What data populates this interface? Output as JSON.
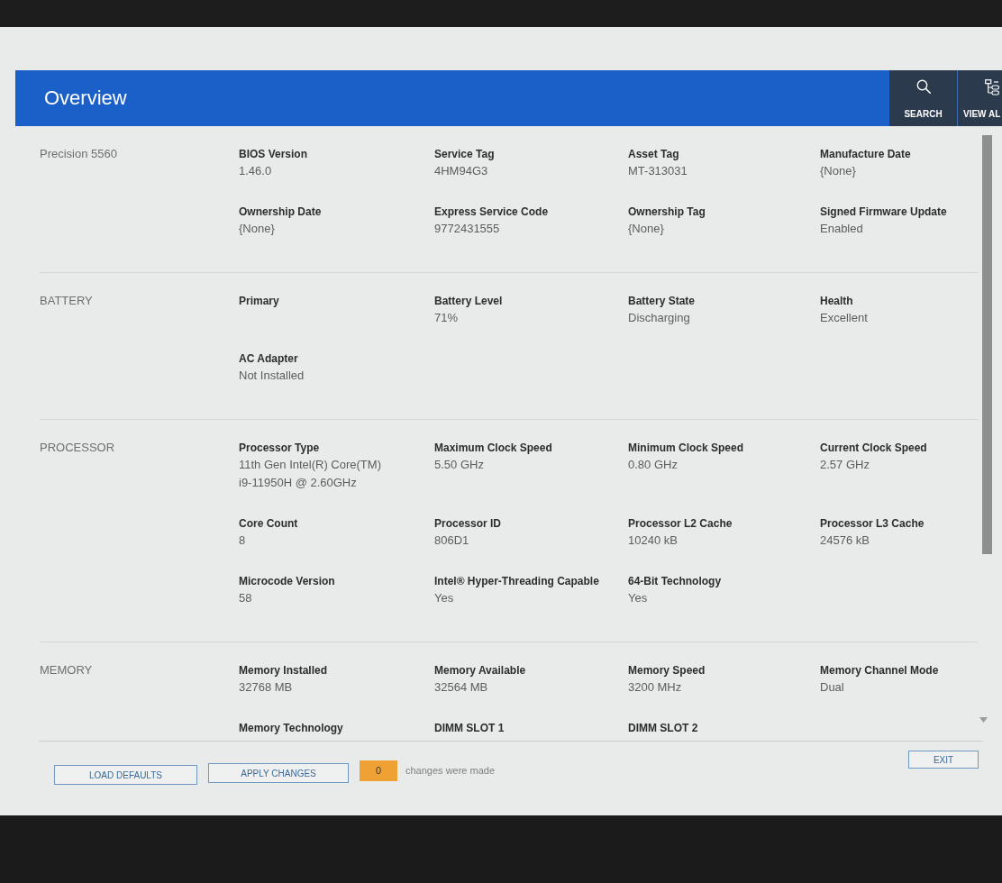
{
  "header": {
    "title": "Overview",
    "actions": [
      {
        "kind": "search",
        "label": "SEARCH"
      },
      {
        "kind": "hierarchy",
        "label": "VIEW AL"
      }
    ]
  },
  "sections": [
    {
      "title": "Precision 5560",
      "fields": [
        {
          "label": "BIOS Version",
          "value": "1.46.0"
        },
        {
          "label": "Service Tag",
          "value": "4HM94G3"
        },
        {
          "label": "Asset Tag",
          "value": "MT-313031"
        },
        {
          "label": "Manufacture Date",
          "value": "{None}"
        },
        {
          "label": "Ownership Date",
          "value": "{None}"
        },
        {
          "label": "Express Service Code",
          "value": "9772431555"
        },
        {
          "label": "Ownership Tag",
          "value": "{None}"
        },
        {
          "label": "Signed Firmware Update",
          "value": "Enabled"
        }
      ]
    },
    {
      "title": "BATTERY",
      "fields": [
        {
          "label": "Primary"
        },
        {
          "label": "Battery Level",
          "value": "71%"
        },
        {
          "label": "Battery State",
          "value": "Discharging"
        },
        {
          "label": "Health",
          "value": "Excellent"
        },
        {
          "label": "AC Adapter",
          "value": "Not Installed"
        }
      ]
    },
    {
      "title": "PROCESSOR",
      "fields": [
        {
          "label": "Processor Type",
          "value": "11th Gen Intel(R) Core(TM) i9-11950H @ 2.60GHz"
        },
        {
          "label": "Maximum Clock Speed",
          "value": "5.50 GHz"
        },
        {
          "label": "Minimum Clock Speed",
          "value": "0.80 GHz"
        },
        {
          "label": "Current Clock Speed",
          "value": "2.57 GHz"
        },
        {
          "label": "Core Count",
          "value": "8"
        },
        {
          "label": "Processor ID",
          "value": "806D1"
        },
        {
          "label": "Processor L2 Cache",
          "value": "10240 kB"
        },
        {
          "label": "Processor L3 Cache",
          "value": "24576 kB"
        },
        {
          "label": "Microcode Version",
          "value": "58"
        },
        {
          "label": "Intel® Hyper-Threading Capable",
          "value": "Yes"
        },
        {
          "label": "64-Bit Technology",
          "value": "Yes"
        }
      ]
    },
    {
      "title": "MEMORY",
      "fields": [
        {
          "label": "Memory Installed",
          "value": "32768 MB"
        },
        {
          "label": "Memory Available",
          "value": "32564 MB"
        },
        {
          "label": "Memory Speed",
          "value": "3200 MHz"
        },
        {
          "label": "Memory Channel Mode",
          "value": "Dual"
        },
        {
          "label": "Memory Technology"
        },
        {
          "label": "DIMM SLOT 1"
        },
        {
          "label": "DIMM SLOT 2"
        }
      ]
    }
  ],
  "footer": {
    "buttons": [
      {
        "label": "LOAD DEFAULTS"
      },
      {
        "label": "APPLY CHANGES"
      }
    ],
    "change_count": "0",
    "change_text": "changes were made",
    "exit_button": "EXIT"
  }
}
